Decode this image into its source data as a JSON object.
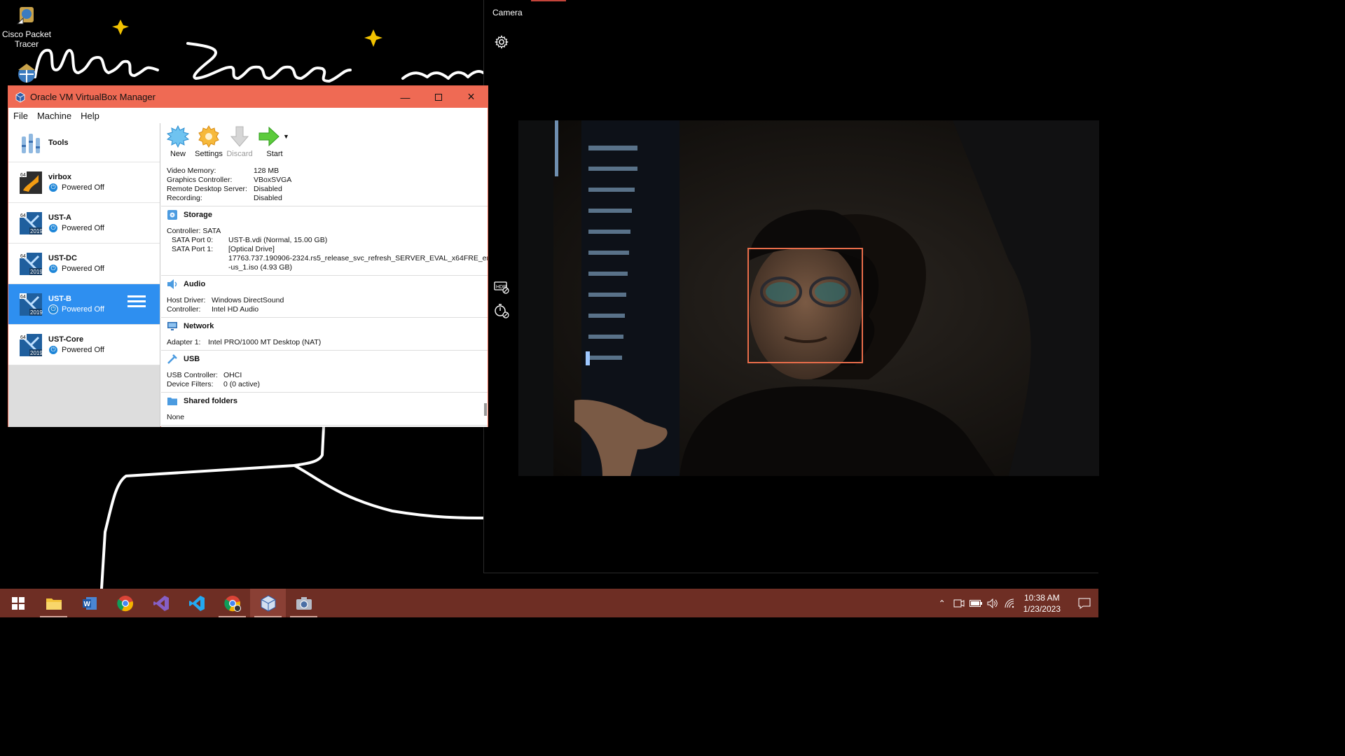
{
  "desktop": {
    "icons": [
      {
        "label": "Cisco Packet Tracer"
      }
    ]
  },
  "vbox": {
    "title": "Oracle VM VirtualBox Manager",
    "menu": [
      "File",
      "Machine",
      "Help"
    ],
    "tools_label": "Tools",
    "vms": [
      {
        "name": "virbox",
        "status": "Powered Off",
        "selected": false
      },
      {
        "name": "UST-A",
        "status": "Powered Off",
        "selected": false
      },
      {
        "name": "UST-DC",
        "status": "Powered Off",
        "selected": false
      },
      {
        "name": "UST-B",
        "status": "Powered Off",
        "selected": true
      },
      {
        "name": "UST-Core",
        "status": "Powered Off",
        "selected": false
      }
    ],
    "toolbar": {
      "new": "New",
      "settings": "Settings",
      "discard": "Discard",
      "start": "Start"
    },
    "display": [
      {
        "k": "Video Memory:",
        "v": "128 MB"
      },
      {
        "k": "Graphics Controller:",
        "v": "VBoxSVGA"
      },
      {
        "k": "Remote Desktop Server:",
        "v": "Disabled"
      },
      {
        "k": "Recording:",
        "v": "Disabled"
      }
    ],
    "storage": {
      "title": "Storage",
      "controller": "Controller: SATA",
      "port0_k": "SATA Port 0:",
      "port0_v": "UST-B.vdi (Normal, 15.00 GB)",
      "port1_k": "SATA Port 1:",
      "port1_v": "[Optical Drive]",
      "iso_1": "17763.737.190906-2324.rs5_release_svc_refresh_SERVER_EVAL_x64FRE_en",
      "iso_2": "-us_1.iso (4.93 GB)"
    },
    "audio": {
      "title": "Audio",
      "rows": [
        {
          "k": "Host Driver:",
          "v": "Windows DirectSound"
        },
        {
          "k": "Controller:",
          "v": "Intel HD Audio"
        }
      ]
    },
    "network": {
      "title": "Network",
      "rows": [
        {
          "k": "Adapter 1:",
          "v": "Intel PRO/1000 MT Desktop (NAT)"
        }
      ]
    },
    "usb": {
      "title": "USB",
      "rows": [
        {
          "k": "USB Controller:",
          "v": "OHCI"
        },
        {
          "k": "Device Filters:",
          "v": "0 (0 active)"
        }
      ]
    },
    "shared": {
      "title": "Shared folders",
      "value": "None"
    }
  },
  "camera": {
    "title": "Camera"
  },
  "taskbar": {
    "time": "10:38 AM",
    "date": "1/23/2023"
  },
  "colors": {
    "vbox_titlebar": "#ef6a54",
    "vm_selected": "#2e8ff0",
    "taskbar": "#6e2e24",
    "face_box": "#e86d4a"
  }
}
